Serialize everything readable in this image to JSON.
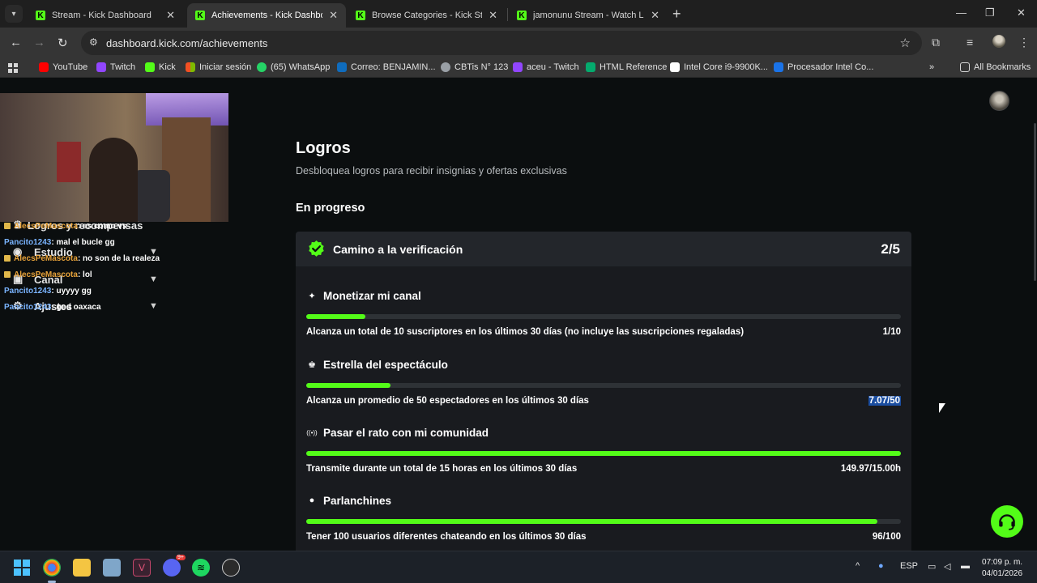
{
  "browser": {
    "tabs": [
      {
        "title": "Stream - Kick Dashboard",
        "active": false
      },
      {
        "title": "Achievements - Kick Dashboard",
        "active": true
      },
      {
        "title": "Browse Categories - Kick Stream",
        "active": false
      },
      {
        "title": "jamonunu Stream - Watch Live",
        "active": false
      }
    ],
    "url": "dashboard.kick.com/achievements",
    "bookmarks": [
      {
        "label": "YouTube",
        "icon": "youtube-icon",
        "color": "#ff0000"
      },
      {
        "label": "Twitch",
        "icon": "twitch-icon",
        "color": "#9146ff"
      },
      {
        "label": "Kick",
        "icon": "kick-icon",
        "color": "#53fc18"
      },
      {
        "label": "Iniciar sesión",
        "icon": "microsoft-icon",
        "color": "#f25022"
      },
      {
        "label": "(65) WhatsApp",
        "icon": "whatsapp-icon",
        "color": "#25d366"
      },
      {
        "label": "Correo: BENJAMIN...",
        "icon": "outlook-icon",
        "color": "#0f6cbd"
      },
      {
        "label": "CBTis N° 123",
        "icon": "globe-icon",
        "color": "#9aa0a6"
      },
      {
        "label": "aceu - Twitch",
        "icon": "twitch-icon",
        "color": "#9146ff"
      },
      {
        "label": "HTML Reference",
        "icon": "w3-icon",
        "color": "#04aa6d"
      },
      {
        "label": "Intel Core i9-9900K...",
        "icon": "amazon-icon",
        "color": "#ffffff"
      },
      {
        "label": "Procesador Intel Co...",
        "icon": "doc-icon",
        "color": "#1a73e8"
      }
    ],
    "more_bookmarks": "»",
    "all_bookmarks": "All Bookmarks"
  },
  "sidebar": {
    "menu": [
      {
        "label": "Logros y recompensas",
        "icon": "trophy-icon"
      },
      {
        "label": "Estudio",
        "icon": "studio-icon"
      },
      {
        "label": "Canal",
        "icon": "channel-icon"
      },
      {
        "label": "Ajustes",
        "icon": "gear-icon"
      }
    ],
    "chat": [
      {
        "user": "AlecsPeMascota",
        "user_color": "#e8a33a",
        "badge": true,
        "text": ": es como vs"
      },
      {
        "user": "Pancito1243",
        "user_color": "#7ab4ff",
        "badge": false,
        "text": ": mal el bucle gg"
      },
      {
        "user": "AlecsPeMascota",
        "user_color": "#e8a33a",
        "badge": true,
        "text": ": no son de la realeza"
      },
      {
        "user": "AlecsPeMascota",
        "user_color": "#e8a33a",
        "badge": true,
        "text": ": lol"
      },
      {
        "user": "Pancito1243",
        "user_color": "#7ab4ff",
        "badge": false,
        "text": ": uyyyy gg"
      },
      {
        "user": "Pancito1243",
        "user_color": "#7ab4ff",
        "badge": false,
        "text": ": god oaxaca"
      }
    ]
  },
  "main": {
    "title": "Logros",
    "subtitle": "Desbloquea logros para recibir insignias y ofertas exclusivas",
    "section": "En progreso",
    "card": {
      "title": "Camino a la verificación",
      "count": "2/5",
      "achievements": [
        {
          "icon": "sparkle-icon",
          "glyph": "✦",
          "title": "Monetizar mi canal",
          "desc": "Alcanza un total de 10 suscriptores en los últimos 30 días (no incluye las suscripciones regaladas)",
          "value": "1/10",
          "progress": 0.1,
          "selected": false
        },
        {
          "icon": "audience-icon",
          "glyph": "♚",
          "title": "Estrella del espectáculo",
          "desc": "Alcanza un promedio de 50 espectadores en los últimos 30 días",
          "value": "7.07/50",
          "progress": 0.1414,
          "selected": true
        },
        {
          "icon": "broadcast-icon",
          "glyph": "((•))",
          "title": "Pasar el rato con mi comunidad",
          "desc": "Transmite durante un total de 15 horas en los últimos 30 días",
          "value": "149.97/15.00h",
          "progress": 1.0,
          "selected": false
        },
        {
          "icon": "chat-bubble-icon",
          "glyph": "●",
          "title": "Parlanchines",
          "desc": "Tener 100 usuarios diferentes chateando en los últimos 30 días",
          "value": "96/100",
          "progress": 0.96,
          "selected": false
        }
      ]
    }
  },
  "taskbar": {
    "language": "ESP",
    "time": "07:09 p. m.",
    "date": "04/01/2026",
    "discord_badge": "9+"
  },
  "colors": {
    "accent": "#53fc18",
    "background": "#0b0e0f",
    "card": "#191b1f"
  }
}
